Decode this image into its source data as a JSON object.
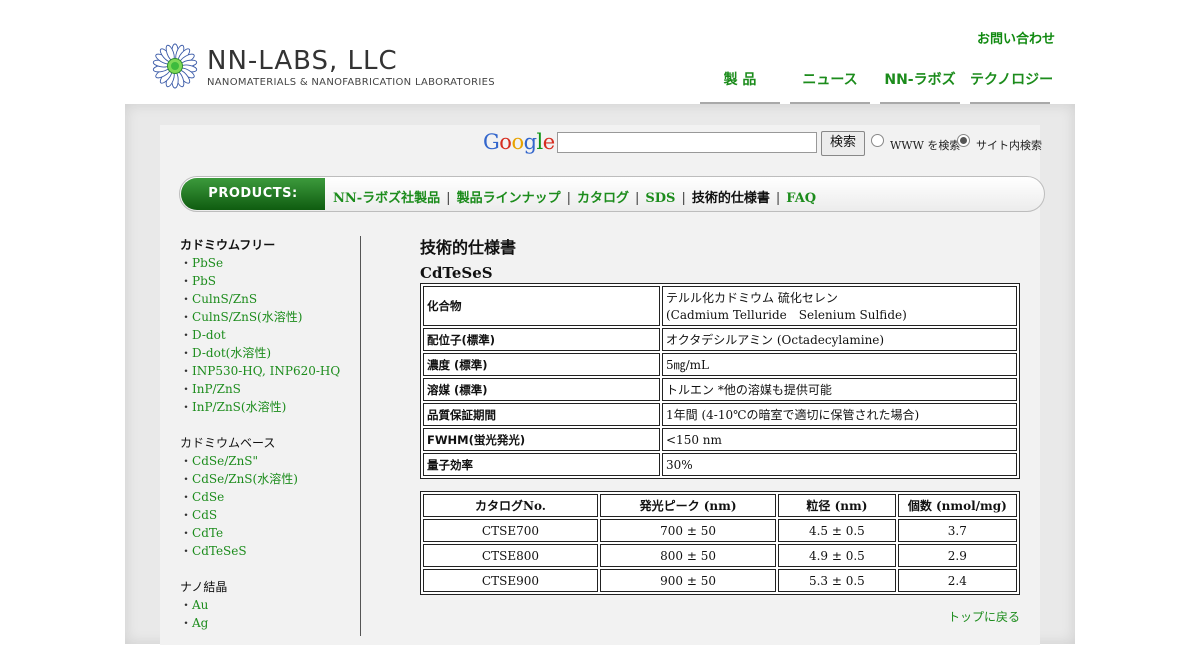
{
  "header": {
    "logo_title": "NN-LABS, LLC",
    "logo_subtitle": "NANOMATERIALS & NANOFABRICATION LABORATORIES",
    "contact_label": "お問い合わせ",
    "nav": [
      {
        "label": "製 品"
      },
      {
        "label": "ニュース"
      },
      {
        "label": "NN-ラボズ"
      },
      {
        "label": "テクノロジー"
      }
    ]
  },
  "search": {
    "logo_text": "Google",
    "input_value": "",
    "button_label": "検索",
    "option_www": "WWW を検索",
    "option_site": "サイト内検索",
    "selected": "site"
  },
  "products_bar": {
    "tab_label": "PRODUCTS:",
    "links": [
      {
        "label": "NN-ラボズ社製品"
      },
      {
        "label": "製品ラインナップ"
      },
      {
        "label": "カタログ"
      },
      {
        "label": "SDS"
      },
      {
        "label": "技術的仕様書"
      },
      {
        "label": "FAQ"
      }
    ]
  },
  "sidebar": {
    "groups": [
      {
        "title": "カドミウムフリー",
        "items": [
          "PbSe",
          "PbS",
          "CulnS/ZnS",
          "CulnS/ZnS(水溶性)",
          "D-dot",
          "D-dot(水溶性)",
          "INP530-HQ, INP620-HQ",
          "InP/ZnS",
          "InP/ZnS(水溶性)"
        ]
      },
      {
        "title": "カドミウムベース",
        "items": [
          "CdSe/ZnS\"",
          "CdSe/ZnS(水溶性)",
          "CdSe",
          "CdS",
          "CdTe",
          "CdTeSeS"
        ]
      },
      {
        "title": "ナノ結晶",
        "items": [
          "Au",
          "Ag"
        ]
      }
    ],
    "bullet": "・"
  },
  "content": {
    "title": "技術的仕様書",
    "product": "CdTeSeS",
    "spec_rows": [
      {
        "label": "化合物",
        "value": "テルル化カドミウム 硫化セレン",
        "value2": "(Cadmium Telluride　Selenium Sulfide)"
      },
      {
        "label": "配位子(標準)",
        "value": "オクタデシルアミン (Octadecylamine)"
      },
      {
        "label": "濃度 (標準)",
        "value": "5㎎/mL"
      },
      {
        "label": "溶媒 (標準)",
        "value": "トルエン *他の溶媒も提供可能"
      },
      {
        "label": "品質保証期間",
        "value": "1年間 (4-10℃の暗室で適切に保管された場合)"
      },
      {
        "label": "FWHM(蛍光発光)",
        "value": "<150 nm"
      },
      {
        "label": "量子効率",
        "value": "30%"
      }
    ],
    "catalog_headers": [
      "カタログNo.",
      "発光ピーク (nm)",
      "粒径 (nm)",
      "個数 (nmol/mg)"
    ],
    "catalog_rows": [
      [
        "CTSE700",
        "700 ± 50",
        "4.5 ± 0.5",
        "3.7"
      ],
      [
        "CTSE800",
        "800 ± 50",
        "4.9 ± 0.5",
        "2.9"
      ],
      [
        "CTSE900",
        "900 ± 50",
        "5.3 ± 0.5",
        "2.4"
      ]
    ],
    "back_to_top": "トップに戻る"
  },
  "colors": {
    "link_green": "#1c8c1c",
    "tab_green": "#0f5c10",
    "google_blue": "#3366cc",
    "google_red": "#d62d20",
    "google_yellow": "#e8a200",
    "google_green": "#109618"
  }
}
